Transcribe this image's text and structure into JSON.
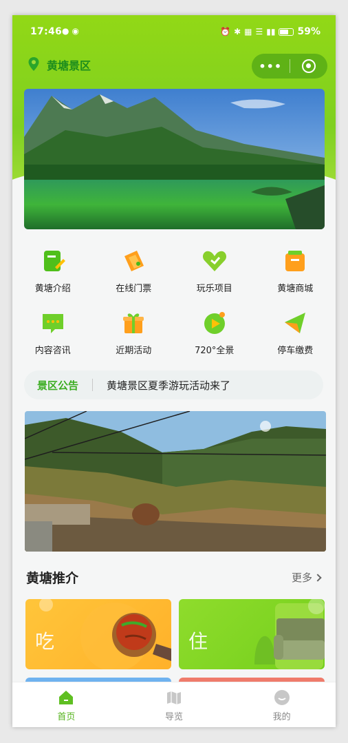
{
  "status_bar": {
    "time": "17:46",
    "battery": "59%",
    "battery_level": 0.59
  },
  "header": {
    "location": "黄塘景区"
  },
  "menu": {
    "items": [
      {
        "label": "黄塘介绍",
        "icon": "doc-edit-icon",
        "color": "#5fc41d"
      },
      {
        "label": "在线门票",
        "icon": "ticket-icon",
        "color": "#ff9f1c"
      },
      {
        "label": "玩乐项目",
        "icon": "heart-icon",
        "color": "#8bd22a"
      },
      {
        "label": "黄塘商城",
        "icon": "shopping-bag-icon",
        "color": "#ff9f1c"
      },
      {
        "label": "内容咨讯",
        "icon": "chat-icon",
        "color": "#6fcf2a"
      },
      {
        "label": "近期活动",
        "icon": "gift-icon",
        "color": "#ff9f1c"
      },
      {
        "label": "720°全景",
        "icon": "play-circle-icon",
        "color": "#6fcf2a"
      },
      {
        "label": "停车缴费",
        "icon": "paper-plane-icon",
        "color": "#6fcf2a"
      }
    ]
  },
  "notice": {
    "tag": "景区公告",
    "text": "黄塘景区夏季游玩活动来了"
  },
  "recommend": {
    "title": "黄塘推介",
    "more": "更多",
    "cards": [
      {
        "label": "吃"
      },
      {
        "label": "住"
      }
    ]
  },
  "tabbar": {
    "tabs": [
      {
        "label": "首页",
        "icon": "home-icon",
        "active": true
      },
      {
        "label": "导览",
        "icon": "map-icon",
        "active": false
      },
      {
        "label": "我的",
        "icon": "profile-icon",
        "active": false
      }
    ]
  },
  "colors": {
    "accent": "#7fd020",
    "active_tab": "#55b31d",
    "notice_tag": "#3bad21"
  }
}
